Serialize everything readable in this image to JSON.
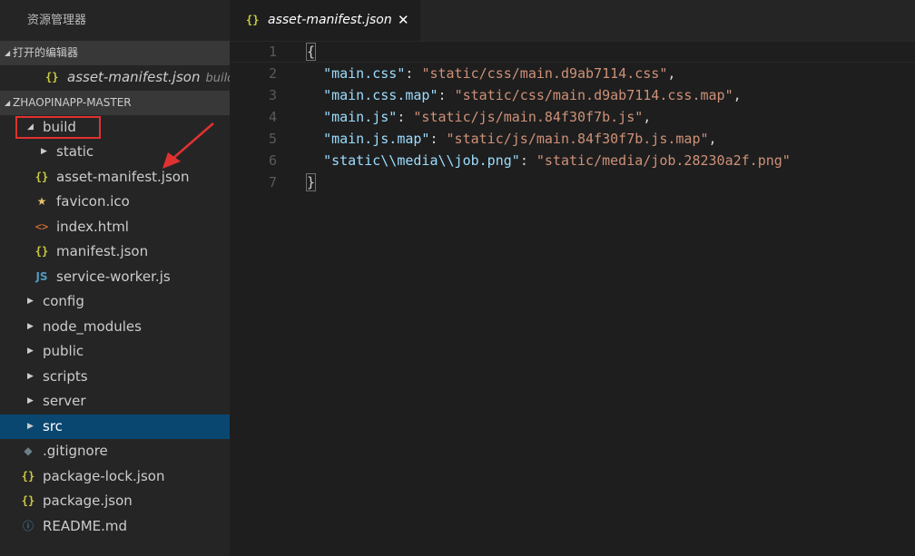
{
  "sidebar": {
    "title": "资源管理器",
    "open_editors": {
      "header": "打开的编辑器",
      "items": [
        {
          "label": "asset-manifest.json",
          "description": "build"
        }
      ]
    },
    "workspace": {
      "header": "ZHAOPINAPP-MASTER"
    },
    "tree": [
      {
        "label": "build",
        "type": "folder",
        "expanded": true,
        "depth": 0
      },
      {
        "label": "static",
        "type": "folder",
        "expanded": false,
        "depth": 1
      },
      {
        "label": "asset-manifest.json",
        "type": "json",
        "depth": 1
      },
      {
        "label": "favicon.ico",
        "type": "ico",
        "depth": 1
      },
      {
        "label": "index.html",
        "type": "html",
        "depth": 1
      },
      {
        "label": "manifest.json",
        "type": "json",
        "depth": 1
      },
      {
        "label": "service-worker.js",
        "type": "js",
        "depth": 1
      },
      {
        "label": "config",
        "type": "folder",
        "expanded": false,
        "depth": 0
      },
      {
        "label": "node_modules",
        "type": "folder",
        "expanded": false,
        "depth": 0
      },
      {
        "label": "public",
        "type": "folder",
        "expanded": false,
        "depth": 0
      },
      {
        "label": "scripts",
        "type": "folder",
        "expanded": false,
        "depth": 0
      },
      {
        "label": "server",
        "type": "folder",
        "expanded": false,
        "depth": 0
      },
      {
        "label": "src",
        "type": "folder",
        "expanded": false,
        "depth": 0,
        "selected": true
      },
      {
        "label": ".gitignore",
        "type": "git",
        "depth": 0
      },
      {
        "label": "package-lock.json",
        "type": "json",
        "depth": 0
      },
      {
        "label": "package.json",
        "type": "json",
        "depth": 0
      },
      {
        "label": "README.md",
        "type": "info",
        "depth": 0
      }
    ]
  },
  "icons": {
    "json": "{}",
    "ico": "★",
    "html": "<>",
    "js": "JS",
    "git": "◆",
    "info": "ⓘ",
    "folder_collapsed": "▶",
    "folder_expanded": "◢",
    "close": "✕"
  },
  "editor": {
    "tab": {
      "label": "asset-manifest.json",
      "icon": "{}",
      "close": "✕"
    },
    "lines": [
      {
        "n": "1",
        "tokens": [
          {
            "t": "{",
            "c": "br"
          }
        ]
      },
      {
        "n": "2",
        "tokens": [
          {
            "t": "  "
          },
          {
            "t": "\"main.css\"",
            "c": "k"
          },
          {
            "t": ": "
          },
          {
            "t": "\"static/css/main.d9ab7114.css\"",
            "c": "s"
          },
          {
            "t": ","
          }
        ]
      },
      {
        "n": "3",
        "tokens": [
          {
            "t": "  "
          },
          {
            "t": "\"main.css.map\"",
            "c": "k"
          },
          {
            "t": ": "
          },
          {
            "t": "\"static/css/main.d9ab7114.css.map\"",
            "c": "s"
          },
          {
            "t": ","
          }
        ]
      },
      {
        "n": "4",
        "tokens": [
          {
            "t": "  "
          },
          {
            "t": "\"main.js\"",
            "c": "k"
          },
          {
            "t": ": "
          },
          {
            "t": "\"static/js/main.84f30f7b.js\"",
            "c": "s"
          },
          {
            "t": ","
          }
        ]
      },
      {
        "n": "5",
        "tokens": [
          {
            "t": "  "
          },
          {
            "t": "\"main.js.map\"",
            "c": "k"
          },
          {
            "t": ": "
          },
          {
            "t": "\"static/js/main.84f30f7b.js.map\"",
            "c": "s"
          },
          {
            "t": ","
          }
        ]
      },
      {
        "n": "6",
        "tokens": [
          {
            "t": "  "
          },
          {
            "t": "\"static\\\\media\\\\job.png\"",
            "c": "k"
          },
          {
            "t": ": "
          },
          {
            "t": "\"static/media/job.28230a2f.png\"",
            "c": "s"
          }
        ]
      },
      {
        "n": "7",
        "tokens": [
          {
            "t": "}",
            "c": "br"
          }
        ]
      }
    ]
  },
  "colors": {
    "sidebar_bg": "#252526",
    "editor_bg": "#1e1e1e",
    "selection": "#094771",
    "highlight_box": "#e03131",
    "json_key": "#9cdcfe",
    "json_string": "#ce9178"
  }
}
